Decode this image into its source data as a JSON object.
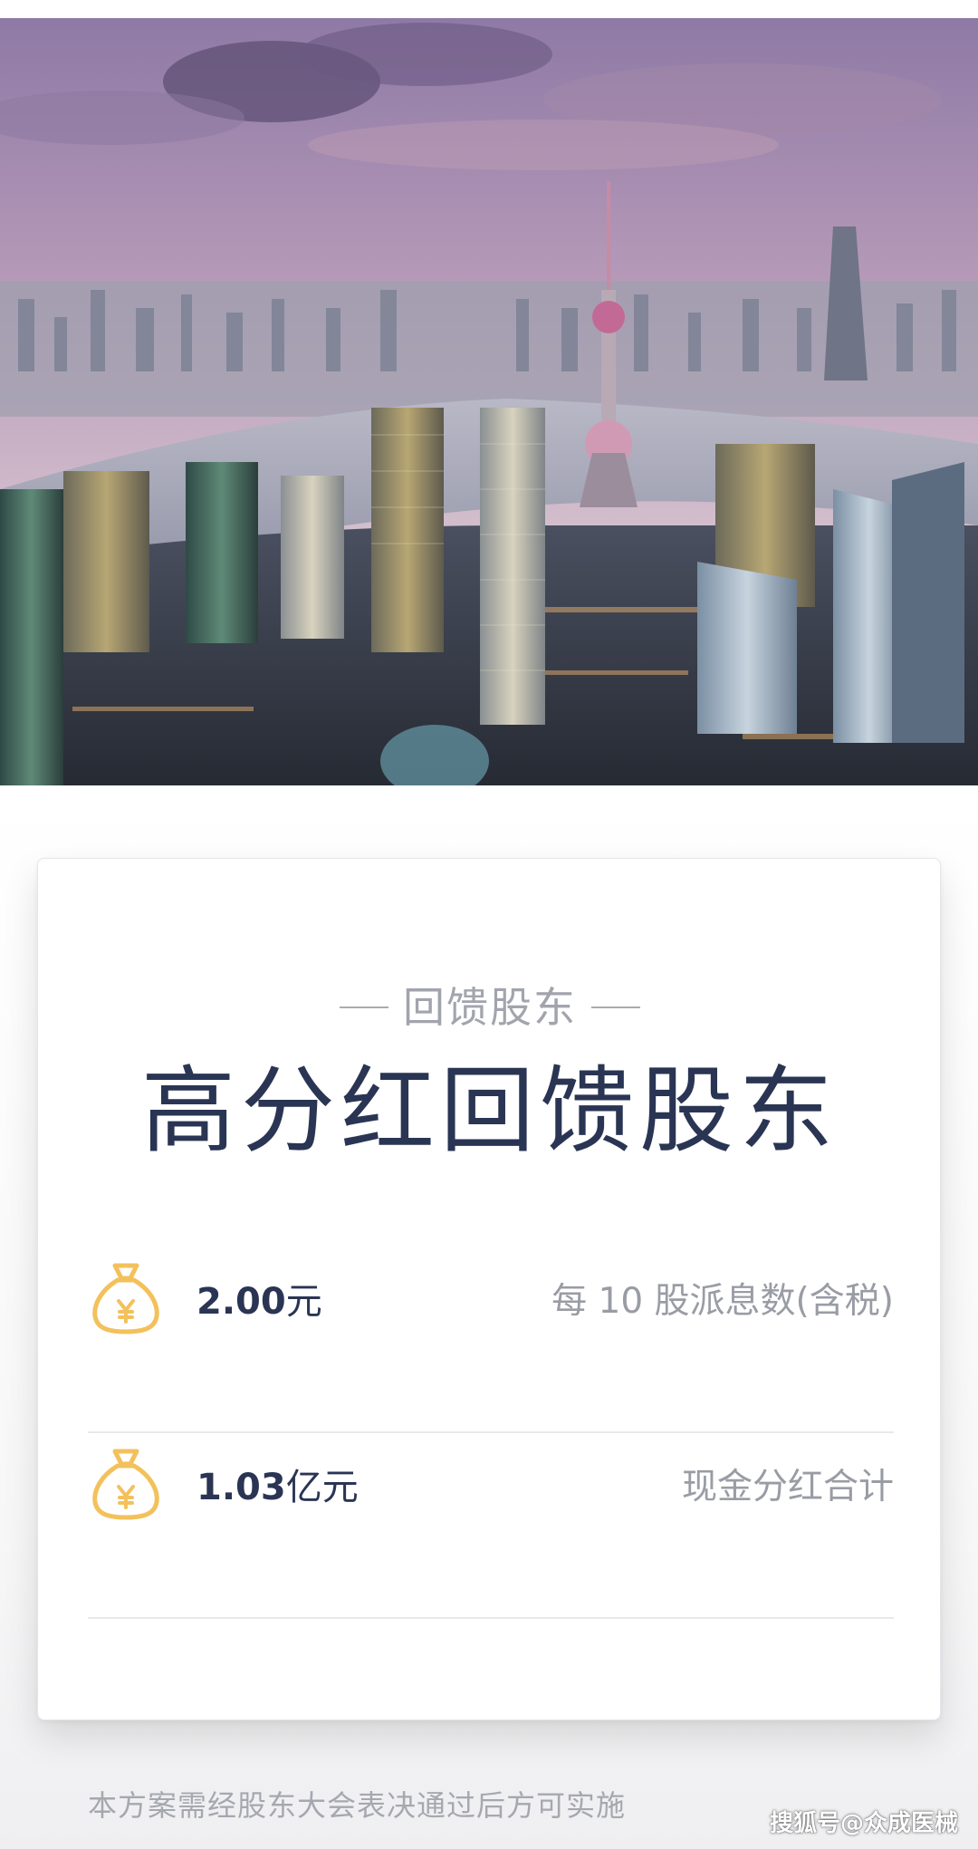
{
  "hero": {
    "image": "shanghai-skyline-photo"
  },
  "dividend": {
    "subtitle": "回馈股东",
    "title": "高分红回馈股东",
    "rows": [
      {
        "icon": "money-bag-icon",
        "amount": "2.00",
        "unit": "元",
        "label": "每 10 股派息数(含税)"
      },
      {
        "icon": "money-bag-icon",
        "amount": "1.03",
        "unit": "亿元",
        "label": "现金分红合计"
      }
    ],
    "footnote": "本方案需经股东大会表决通过后方可实施"
  },
  "watermark": {
    "text": "搜狐号@众成医械"
  },
  "colors": {
    "title": "#2a3554",
    "muted": "#9a9ca5",
    "icon": "#f3c15b"
  }
}
